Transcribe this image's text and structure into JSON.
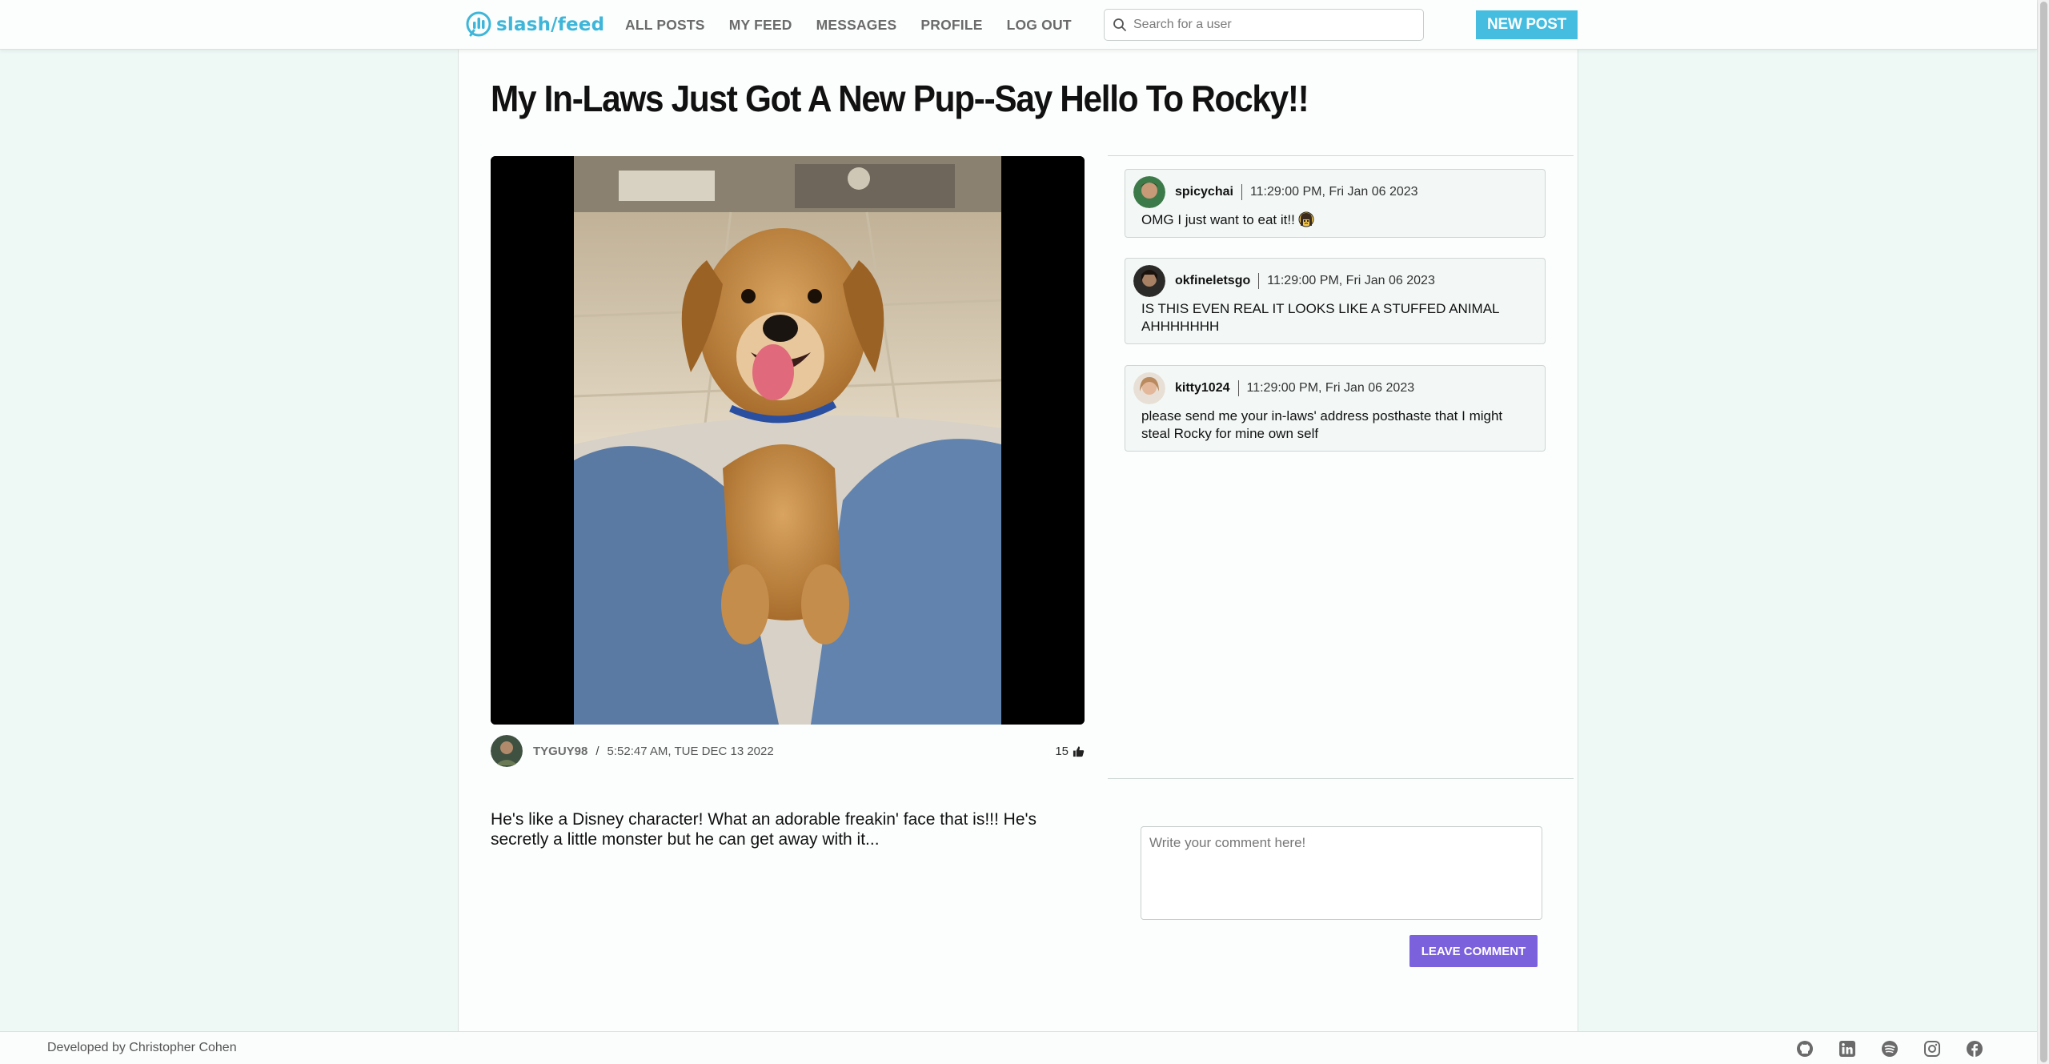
{
  "nav": {
    "logo_text": "slash/feed",
    "links": [
      "ALL POSTS",
      "MY FEED",
      "MESSAGES",
      "PROFILE",
      "LOG OUT"
    ],
    "search_placeholder": "Search for a user",
    "new_post_label": "NEW POST"
  },
  "post": {
    "title": "My In-Laws Just Got A New Pup--Say Hello To Rocky!!",
    "author": "TYGUY98",
    "separator": "/",
    "date": "5:52:47 AM, TUE DEC 13 2022",
    "likes": "15",
    "body": "He's like a Disney character! What an adorable freakin' face that is!!! He's secretly a little monster but he can get away with it..."
  },
  "comments": [
    {
      "username": "spicychai",
      "time": "11:29:00 PM, Fri Jan 06 2023",
      "text": "OMG I just want to eat it!!",
      "emoji": "pleading-face-icon"
    },
    {
      "username": "okfineletsgo",
      "time": "11:29:00 PM, Fri Jan 06 2023",
      "text": "IS THIS EVEN REAL IT LOOKS LIKE A STUFFED ANIMAL AHHHHHHH"
    },
    {
      "username": "kitty1024",
      "time": "11:29:00 PM, Fri Jan 06 2023",
      "text": "please send me your in-laws' address posthaste that I might steal Rocky for mine own self"
    }
  ],
  "comment_form": {
    "placeholder": "Write your comment here!",
    "submit_label": "LEAVE COMMENT"
  },
  "footer": {
    "credit": "Developed by Christopher Cohen",
    "social_icons": [
      "github-icon",
      "linkedin-icon",
      "spotify-icon",
      "instagram-icon",
      "facebook-icon"
    ]
  },
  "colors": {
    "brand": "#44bde0",
    "accent_button": "#7b61dc",
    "page_background": "#eef8f5"
  }
}
